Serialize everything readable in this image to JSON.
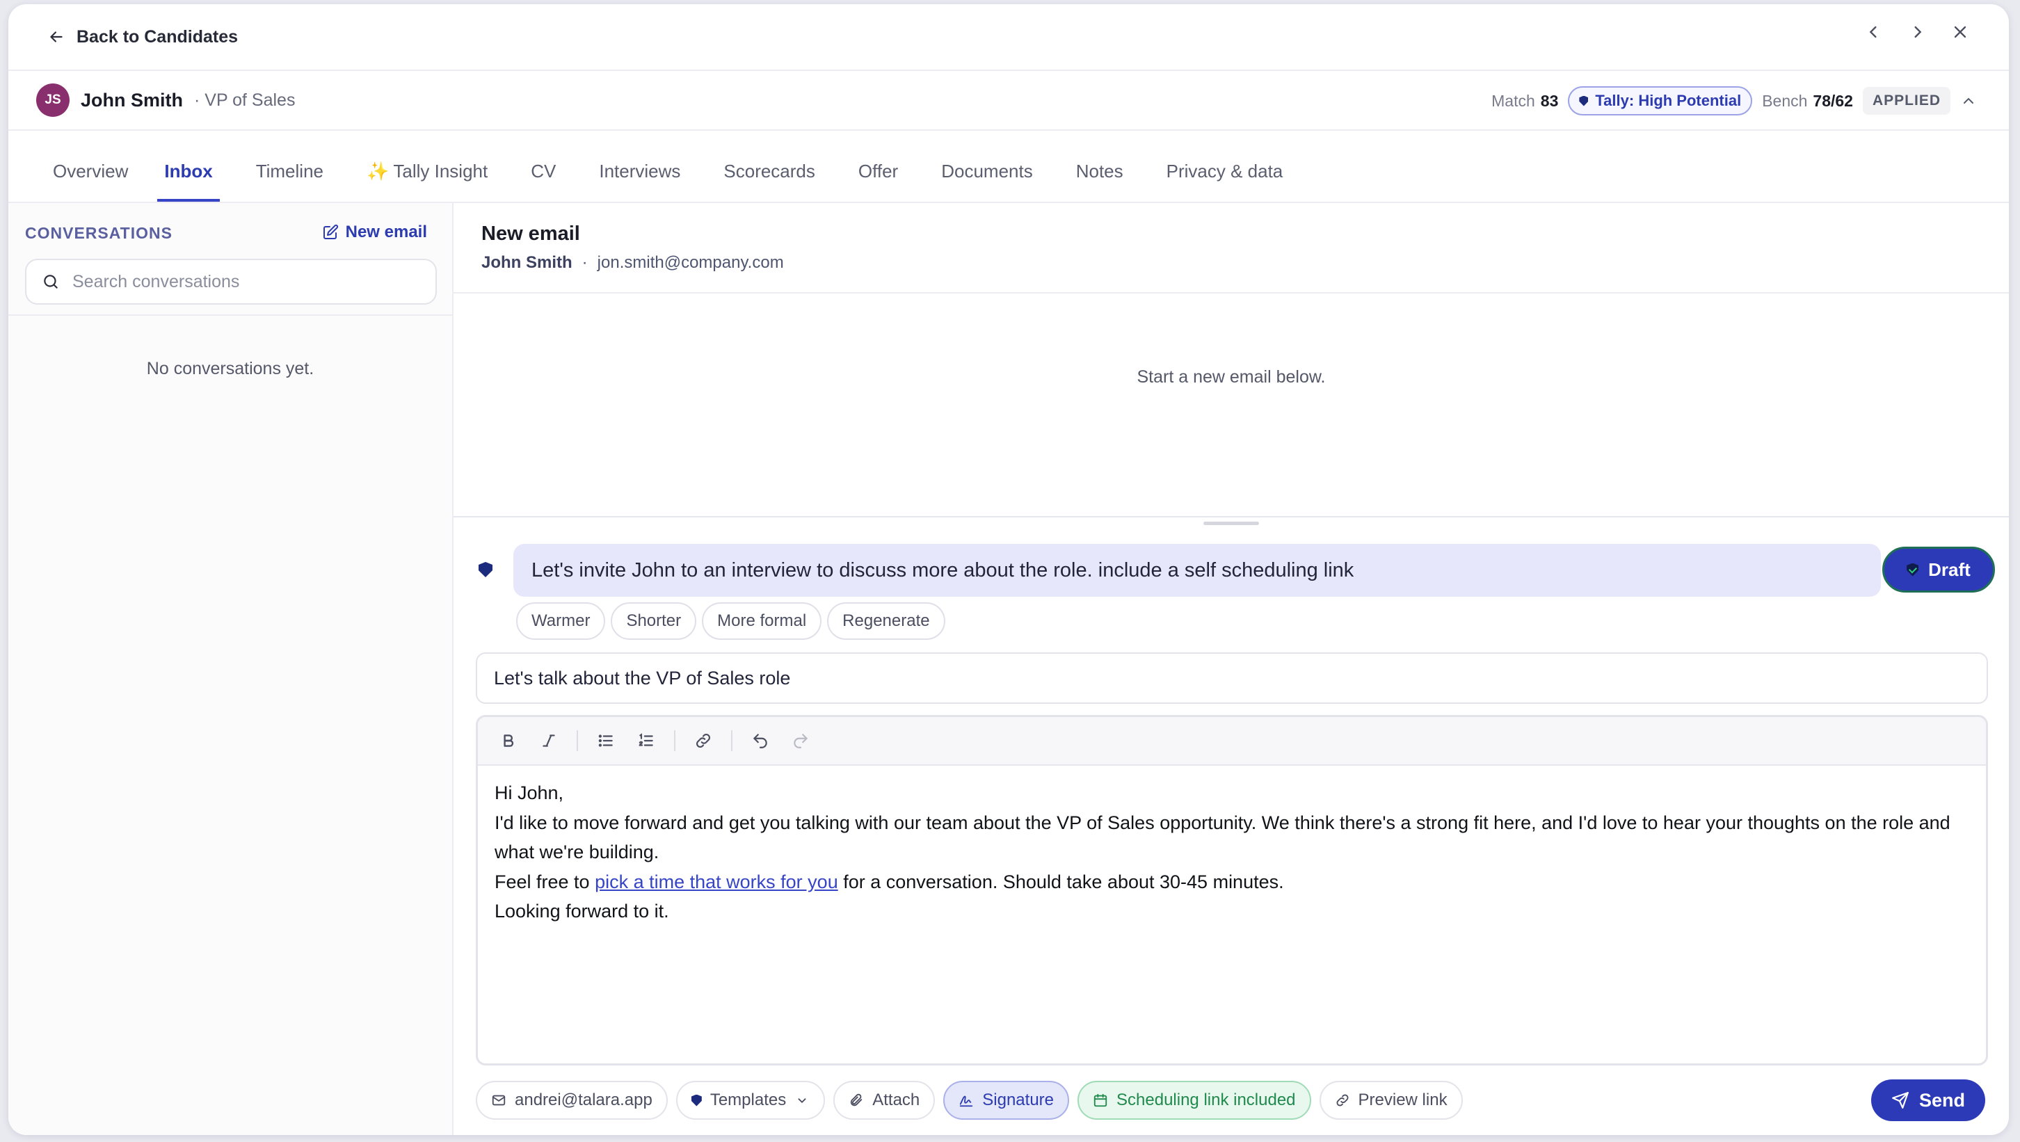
{
  "topbar": {
    "back_label": "Back to Candidates"
  },
  "candidate": {
    "initials": "JS",
    "name": "John Smith",
    "role": "· VP of Sales",
    "match_label": "Match",
    "match_value": "83",
    "tally_label": "Tally: High Potential",
    "bench_label": "Bench",
    "bench_value": "78/62",
    "status": "APPLIED"
  },
  "tabs": [
    {
      "label": "Overview"
    },
    {
      "label": "Inbox",
      "active": true
    },
    {
      "label": "Timeline"
    },
    {
      "label": "Tally Insight",
      "icon": "sparkle-icon"
    },
    {
      "label": "CV"
    },
    {
      "label": "Interviews"
    },
    {
      "label": "Scorecards"
    },
    {
      "label": "Offer"
    },
    {
      "label": "Documents"
    },
    {
      "label": "Notes"
    },
    {
      "label": "Privacy & data"
    }
  ],
  "sparkle": "✨",
  "sidebar": {
    "heading": "CONVERSATIONS",
    "new_email_label": "New email",
    "search_placeholder": "Search conversations",
    "empty_text": "No conversations yet."
  },
  "email": {
    "title": "New email",
    "recipient_name": "John Smith",
    "separator": "·",
    "recipient_email": "jon.smith@company.com",
    "empty_text": "Start a new email below."
  },
  "ai": {
    "prompt": "Let's invite John to an interview to discuss more about the role. include a self scheduling link",
    "draft_label": "Draft",
    "chips": [
      "Warmer",
      "Shorter",
      "More formal",
      "Regenerate"
    ]
  },
  "subject": "Let's talk about the VP of Sales role",
  "body": {
    "greeting": "Hi John,",
    "para1": "I'd like to move forward and get you talking with our team about the VP of Sales opportunity. We think there's a strong fit here, and I'd love to hear your thoughts on the role and what we're building.",
    "para2_before": "Feel free to ",
    "para2_link": "pick a time that works for you",
    "para2_after": " for a conversation. Should take about 30-45 minutes.",
    "closing": "Looking forward to it."
  },
  "footer": {
    "from": "andrei@talara.app",
    "templates": "Templates",
    "attach": "Attach",
    "signature": "Signature",
    "scheduling": "Scheduling link included",
    "preview": "Preview link",
    "send": "Send"
  },
  "colors": {
    "accent": "#2d3ab8",
    "avatar": "#8a2f6e",
    "success": "#1f8a4c"
  }
}
